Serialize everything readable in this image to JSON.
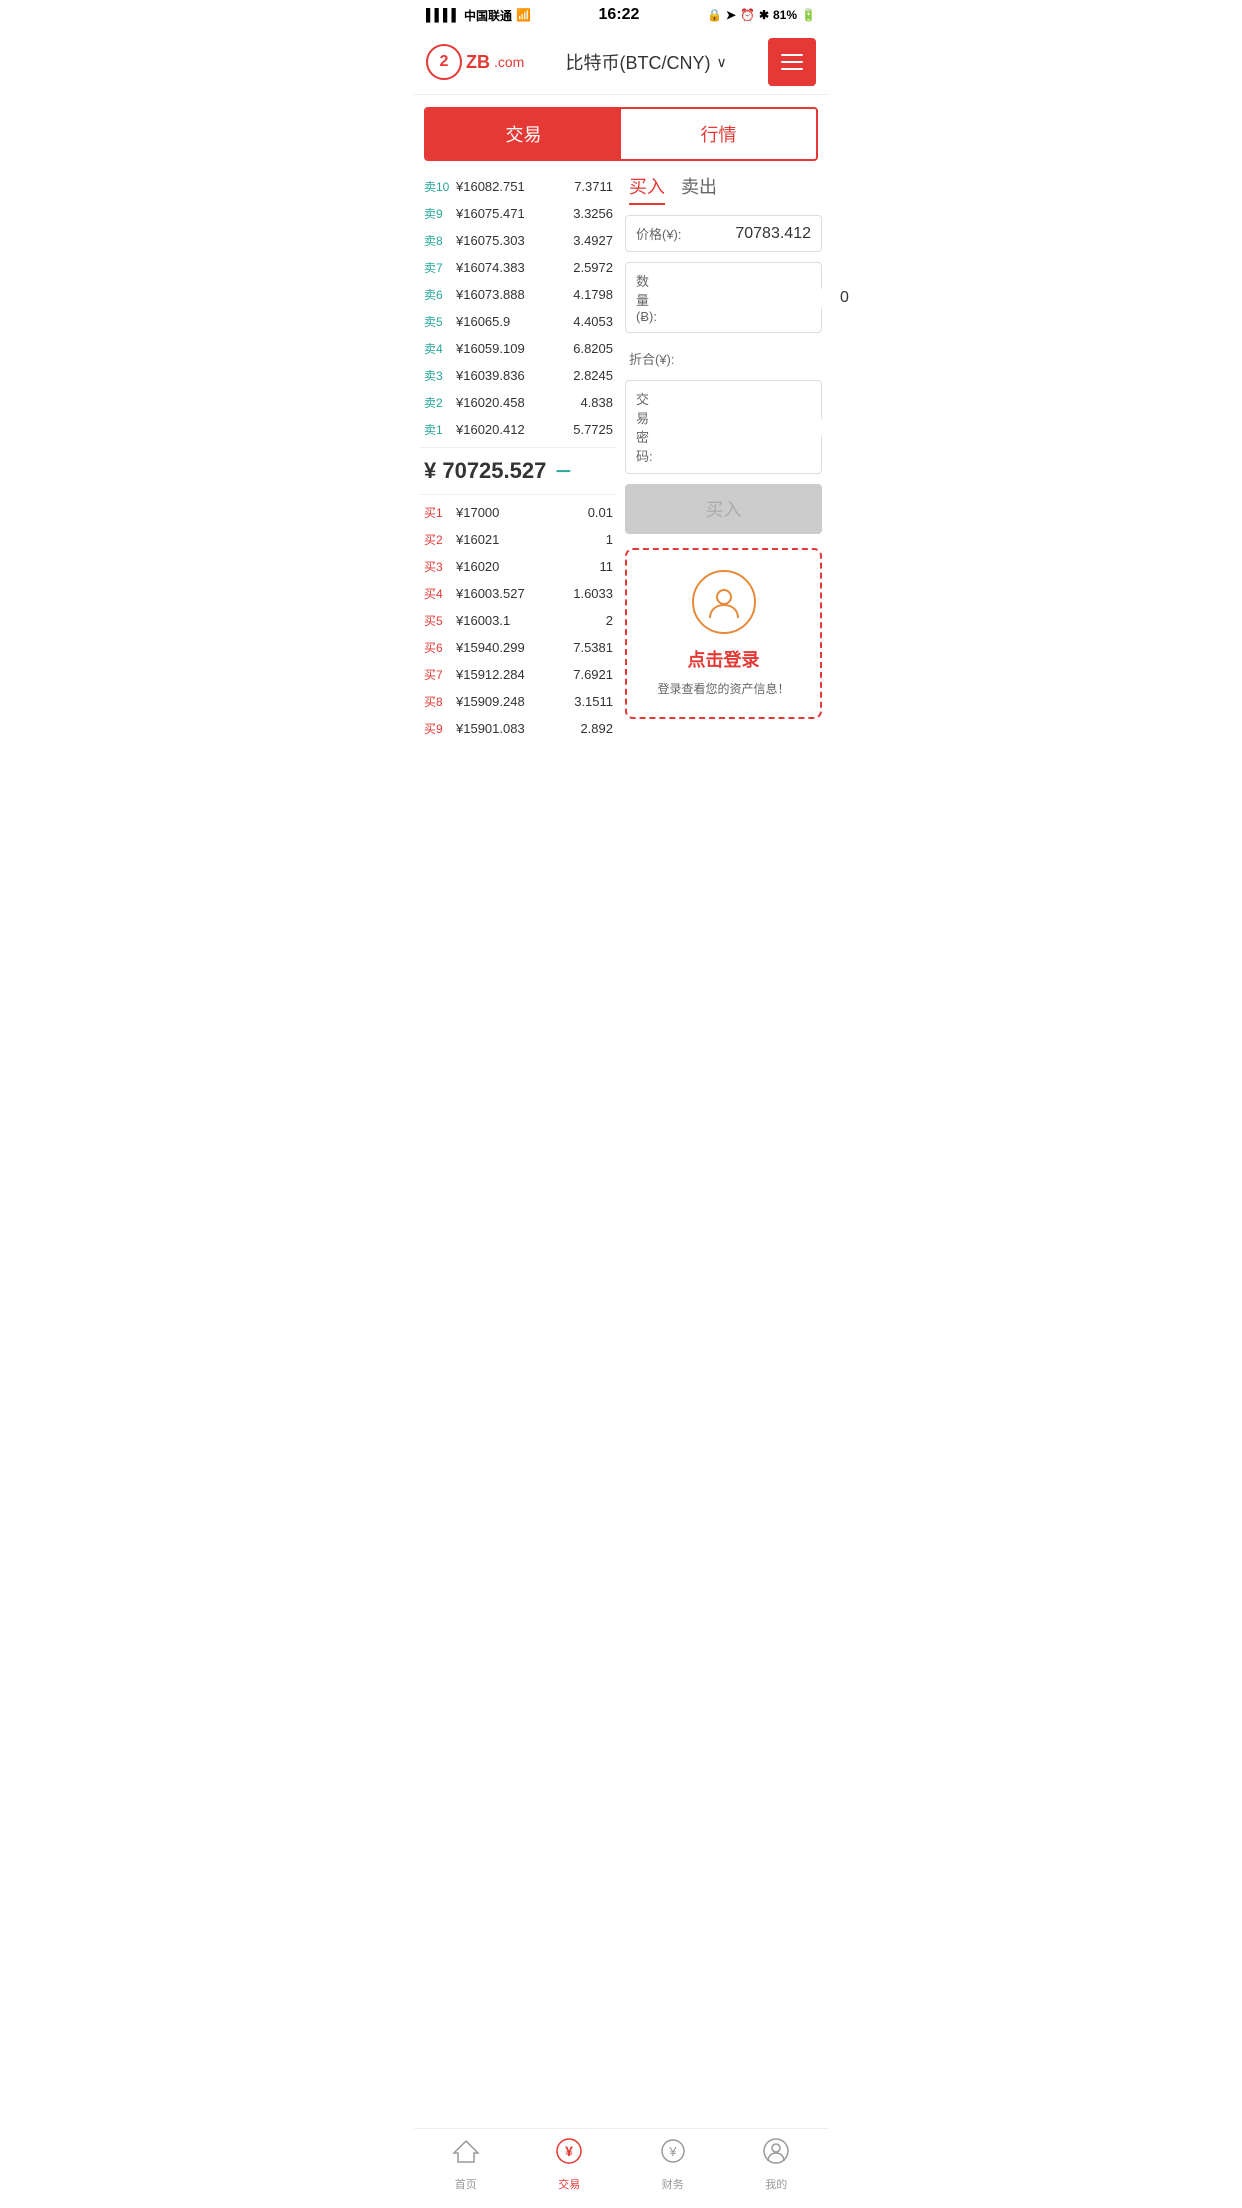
{
  "statusBar": {
    "carrier": "中国联通",
    "time": "16:22",
    "battery": "81%"
  },
  "header": {
    "title": "比特币(BTC/CNY)",
    "menuLabel": "menu"
  },
  "mainTabs": {
    "tab1": "交易",
    "tab2": "行情",
    "activeTab": "tab1"
  },
  "orderBook": {
    "sellOrders": [
      {
        "label": "卖10",
        "price": "¥16082.751",
        "qty": "7.3711"
      },
      {
        "label": "卖9",
        "price": "¥16075.471",
        "qty": "3.3256"
      },
      {
        "label": "卖8",
        "price": "¥16075.303",
        "qty": "3.4927"
      },
      {
        "label": "卖7",
        "price": "¥16074.383",
        "qty": "2.5972"
      },
      {
        "label": "卖6",
        "price": "¥16073.888",
        "qty": "4.1798"
      },
      {
        "label": "卖5",
        "price": "¥16065.9",
        "qty": "4.4053"
      },
      {
        "label": "卖4",
        "price": "¥16059.109",
        "qty": "6.8205"
      },
      {
        "label": "卖3",
        "price": "¥16039.836",
        "qty": "2.8245"
      },
      {
        "label": "卖2",
        "price": "¥16020.458",
        "qty": "4.838"
      },
      {
        "label": "卖1",
        "price": "¥16020.412",
        "qty": "5.7725"
      }
    ],
    "midPrice": "¥ 70725.527",
    "midSymbol": "－",
    "buyOrders": [
      {
        "label": "买1",
        "price": "¥17000",
        "qty": "0.01"
      },
      {
        "label": "买2",
        "price": "¥16021",
        "qty": "1"
      },
      {
        "label": "买3",
        "price": "¥16020",
        "qty": "11"
      },
      {
        "label": "买4",
        "price": "¥16003.527",
        "qty": "1.6033"
      },
      {
        "label": "买5",
        "price": "¥16003.1",
        "qty": "2"
      },
      {
        "label": "买6",
        "price": "¥15940.299",
        "qty": "7.5381"
      },
      {
        "label": "买7",
        "price": "¥15912.284",
        "qty": "7.6921"
      },
      {
        "label": "买8",
        "price": "¥15909.248",
        "qty": "3.1511"
      },
      {
        "label": "买9",
        "price": "¥15901.083",
        "qty": "2.892"
      }
    ]
  },
  "tradePanel": {
    "buyTabLabel": "买入",
    "sellTabLabel": "卖出",
    "priceLabel": "价格(¥):",
    "priceValue": "70783.412",
    "qtyLabel": "数量(Ƀ):",
    "qtyValue": "0",
    "totalLabel": "折合(¥):",
    "totalValue": "",
    "passwordLabel": "交易密码:",
    "buyBtnLabel": "买入"
  },
  "loginPanel": {
    "clickText": "点击登录",
    "subText": "登录查看您的资产信息！"
  },
  "bottomNav": [
    {
      "label": "首页",
      "icon": "☆",
      "active": false
    },
    {
      "label": "交易",
      "icon": "¥",
      "active": true
    },
    {
      "label": "财务",
      "icon": "◎",
      "active": false
    },
    {
      "label": "我的",
      "icon": "👤",
      "active": false
    }
  ]
}
